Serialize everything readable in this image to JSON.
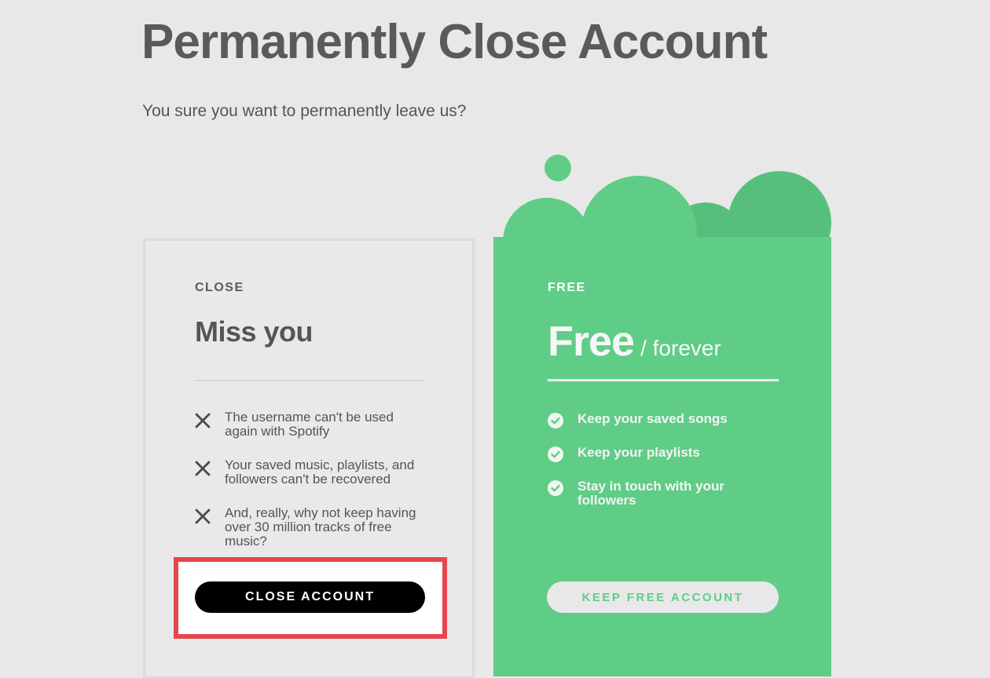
{
  "page": {
    "title": "Permanently Close Account",
    "subtitle": "You sure you want to permanently leave us?"
  },
  "close_card": {
    "eyebrow": "CLOSE",
    "heading": "Miss you",
    "items": [
      {
        "icon": "x-icon",
        "text": "The username can't be used again with Spotify"
      },
      {
        "icon": "x-icon",
        "text": "Your saved music, playlists, and followers can't be recovered"
      },
      {
        "icon": "x-icon",
        "text": "And, really, why not keep having over 30 million tracks of free music?"
      }
    ],
    "button_label": "CLOSE ACCOUNT"
  },
  "free_card": {
    "eyebrow": "FREE",
    "heading_main": "Free",
    "heading_suffix": "/ forever",
    "items": [
      {
        "icon": "check-circle-icon",
        "text": "Keep your saved songs"
      },
      {
        "icon": "check-circle-icon",
        "text": "Keep your playlists"
      },
      {
        "icon": "check-circle-icon",
        "text": "Stay in touch with your followers"
      }
    ],
    "button_label": "KEEP FREE ACCOUNT"
  },
  "colors": {
    "background": "#e8e8e8",
    "brand_green": "#5fcd86",
    "highlight": "#e8464e"
  }
}
